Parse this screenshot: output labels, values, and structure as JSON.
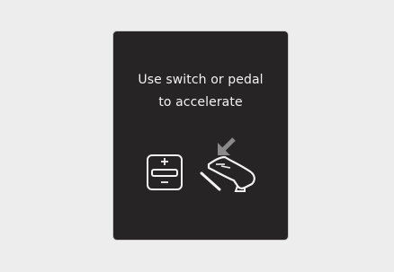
{
  "display": {
    "line1": "Use switch or pedal",
    "line2": "to accelerate"
  },
  "icons": {
    "switch": "accelerate-switch-icon",
    "pedal": "accelerator-pedal-icon"
  },
  "colors": {
    "background": "#ededed",
    "panel": "#262424",
    "foreground": "#f2f2f2",
    "arrow": "#8a8a8a"
  }
}
